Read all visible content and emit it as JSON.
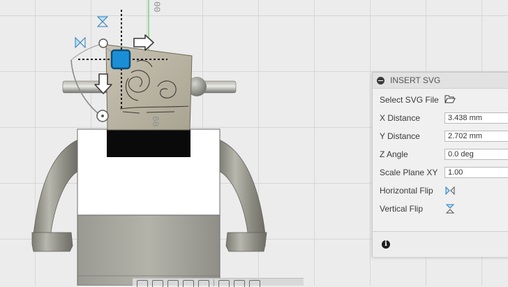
{
  "ruler": {
    "label_top": "00",
    "label_mid": "60"
  },
  "panel": {
    "title": "INSERT SVG",
    "select_svg_file_label": "Select SVG File",
    "x_distance_label": "X Distance",
    "x_distance_value": "3.438 mm",
    "y_distance_label": "Y Distance",
    "y_distance_value": "2.702 mm",
    "z_angle_label": "Z Angle",
    "z_angle_value": "0.0 deg",
    "scale_plane_label": "Scale Plane XY",
    "scale_plane_value": "1.00",
    "horizontal_flip_label": "Horizontal Flip",
    "vertical_flip_label": "Vertical Flip",
    "icons": {
      "collapse": "minus-circle-icon",
      "select_file": "folder-open-icon",
      "horizontal_flip": "horizontal-flip-icon",
      "vertical_flip": "vertical-flip-icon",
      "info": "info-icon"
    }
  },
  "colors": {
    "gizmo_handle": "#1a8fd6",
    "axis_green": "#3ec93e",
    "canvas_bg": "#ececec"
  }
}
